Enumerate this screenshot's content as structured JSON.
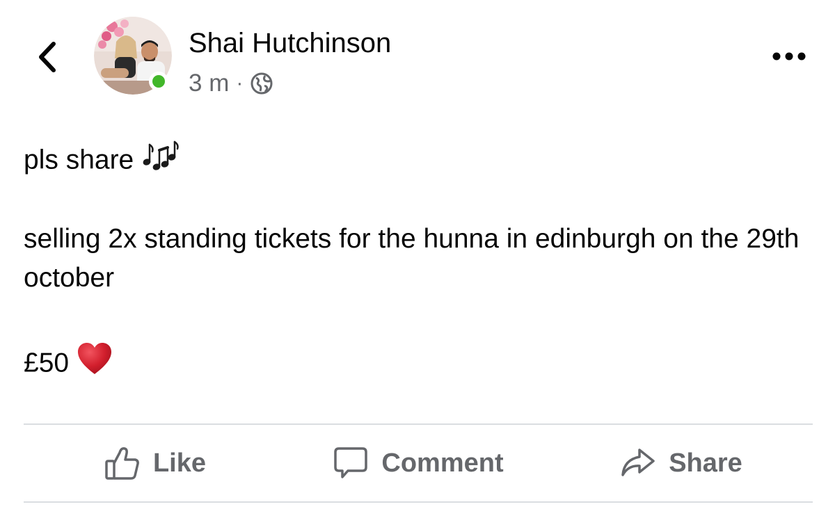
{
  "post": {
    "author_name": "Shai Hutchinson",
    "time": "3 m",
    "separator": "·",
    "privacy_icon": "globe-icon",
    "online": true,
    "text_line1": "pls share ",
    "text_line2": "selling 2x standing tickets for the hunna in edinburgh on the 29th october",
    "text_line3": "£50 ",
    "emoji_music": "music-notes-icon",
    "emoji_heart": "red-heart-icon"
  },
  "actions": {
    "like_label": "Like",
    "comment_label": "Comment",
    "share_label": "Share"
  },
  "colors": {
    "text": "#050505",
    "secondary": "#65676b",
    "online": "#42b72a",
    "divider": "#dadde1",
    "heart": "#d21f2d"
  }
}
